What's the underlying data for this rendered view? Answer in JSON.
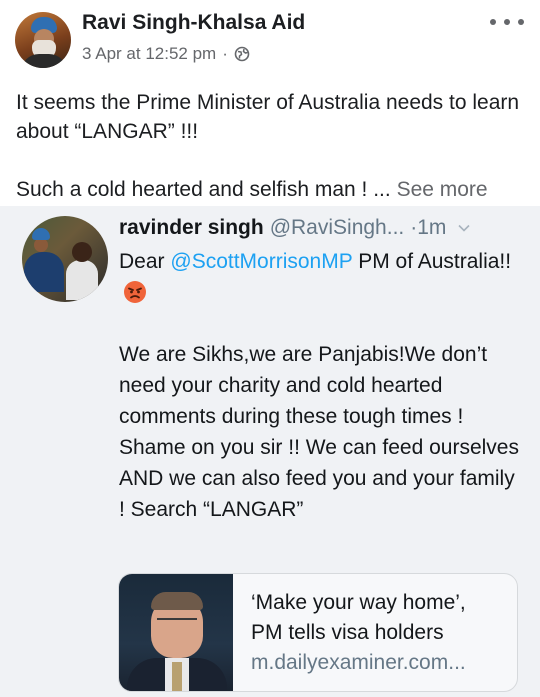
{
  "post": {
    "author": "Ravi Singh-Khalsa Aid",
    "timestamp": "3 Apr at 12:52 pm",
    "separator": "·",
    "privacy_icon": "globe-icon",
    "more_icon": "more-options-icon",
    "text_line1": "It seems the Prime Minister of Australia needs to learn about “LANGAR” !!!",
    "text_line2": "Such a cold hearted and selfish man ! ...",
    "see_more": "See more"
  },
  "tweet": {
    "name": "ravinder singh",
    "handle": "@RaviSingh...",
    "time": "·1m",
    "line1_prefix": "Dear",
    "mention": "@ScottMorrisonMP",
    "line1_suffix": "PM of Australia!!",
    "emoji": "angry-face-icon",
    "body": "We are Sikhs,we are Panjabis!We don’t need your charity and cold hearted comments during these tough times ! Shame on you sir !! We can feed ourselves AND we can also feed you and your family ! Search “LANGAR”",
    "card": {
      "title_line1": "‘Make your way home’,",
      "title_line2": "PM tells visa holders",
      "url": "m.dailyexaminer.com..."
    }
  },
  "colors": {
    "text": "#1c1e21",
    "muted": "#65676b",
    "twitter_blue": "#1da1f2",
    "tweet_bg": "#f0f2f5"
  }
}
